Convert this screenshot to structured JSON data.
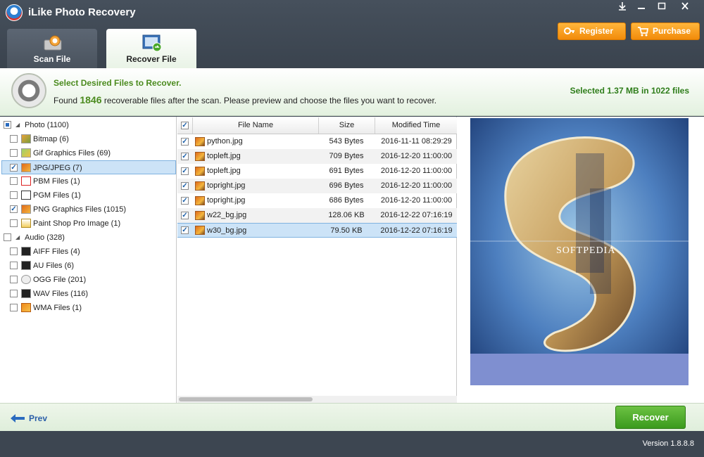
{
  "app": {
    "title": "iLike Photo Recovery",
    "version": "Version 1.8.8.8"
  },
  "window_controls": [
    "download-icon",
    "minimize-icon",
    "maximize-icon",
    "close-icon"
  ],
  "tabs": [
    {
      "label": "Scan File",
      "icon": "scan-icon",
      "active": false
    },
    {
      "label": "Recover File",
      "icon": "recover-file-icon",
      "active": true
    }
  ],
  "top_buttons": {
    "register": "Register",
    "purchase": "Purchase"
  },
  "banner": {
    "title": "Select Desired Files to Recover.",
    "desc_prefix": "Found ",
    "count": "1846",
    "desc_suffix": " recoverable files after the scan. Please preview and choose the files you want to recover.",
    "selected": "Selected 1.37 MB in 1022 files"
  },
  "tree": [
    {
      "label": "Photo (1100)",
      "level": 0,
      "state": "partial",
      "icon": ""
    },
    {
      "label": "Bitmap (6)",
      "level": 1,
      "state": "unchecked",
      "icon": "bitmap-icon"
    },
    {
      "label": "Gif Graphics Files (69)",
      "level": 1,
      "state": "unchecked",
      "icon": "gif-icon"
    },
    {
      "label": "JPG/JPEG (7)",
      "level": 1,
      "state": "checked",
      "icon": "jpg-icon",
      "selected": true
    },
    {
      "label": "PBM Files (1)",
      "level": 1,
      "state": "unchecked",
      "icon": "pbm-icon"
    },
    {
      "label": "PGM Files (1)",
      "level": 1,
      "state": "unchecked",
      "icon": "sony-icon"
    },
    {
      "label": "PNG Graphics Files (1015)",
      "level": 1,
      "state": "checked",
      "icon": "png-icon"
    },
    {
      "label": "Paint Shop Pro Image (1)",
      "level": 1,
      "state": "unchecked",
      "icon": "psp-icon"
    },
    {
      "label": "Audio (328)",
      "level": 0,
      "state": "unchecked",
      "icon": ""
    },
    {
      "label": "AIFF Files (4)",
      "level": 1,
      "state": "unchecked",
      "icon": "aiff-icon"
    },
    {
      "label": "AU Files (6)",
      "level": 1,
      "state": "unchecked",
      "icon": "au-icon"
    },
    {
      "label": "OGG File (201)",
      "level": 1,
      "state": "unchecked",
      "icon": "ogg-icon"
    },
    {
      "label": "WAV Files (116)",
      "level": 1,
      "state": "unchecked",
      "icon": "wav-icon"
    },
    {
      "label": "WMA Files (1)",
      "level": 1,
      "state": "unchecked",
      "icon": "wma-icon"
    }
  ],
  "file_table": {
    "columns": [
      "File Name",
      "Size",
      "Modified Time"
    ],
    "rows": [
      {
        "name": "python.jpg",
        "size": "543 Bytes",
        "modified": "2016-11-11 08:29:29"
      },
      {
        "name": "topleft.jpg",
        "size": "709 Bytes",
        "modified": "2016-12-20 11:00:00"
      },
      {
        "name": "topleft.jpg",
        "size": "691 Bytes",
        "modified": "2016-12-20 11:00:00"
      },
      {
        "name": "topright.jpg",
        "size": "696 Bytes",
        "modified": "2016-12-20 11:00:00"
      },
      {
        "name": "topright.jpg",
        "size": "686 Bytes",
        "modified": "2016-12-20 11:00:00"
      },
      {
        "name": "w22_bg.jpg",
        "size": "128.06 KB",
        "modified": "2016-12-22 07:16:19"
      },
      {
        "name": "w30_bg.jpg",
        "size": "79.50 KB",
        "modified": "2016-12-22 07:16:19"
      }
    ]
  },
  "preview": {
    "watermark": "SOFTPEDIA"
  },
  "bottom": {
    "prev": "Prev",
    "recover": "Recover"
  },
  "colors": {
    "accent_green": "#4b8b1e",
    "orange_button": "#f28b0a",
    "chrome_dark": "#3d4651",
    "selection_blue": "#cce3f7"
  }
}
